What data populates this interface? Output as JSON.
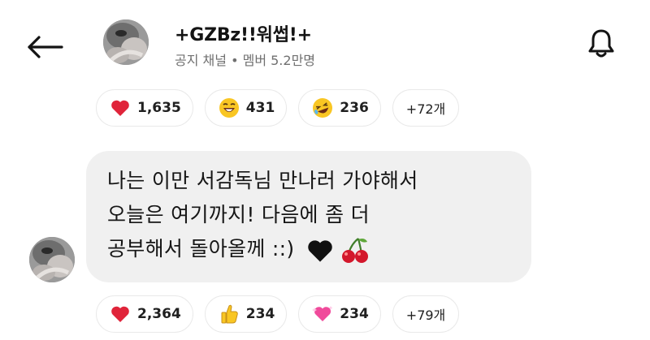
{
  "header": {
    "channel_name": "+GZBz!!워썹!+",
    "channel_type": "공지 채널",
    "separator": "•",
    "members": "멤버 5.2만명"
  },
  "icons": {
    "back": "arrow-left-icon",
    "bell": "bell-icon"
  },
  "reactions_top": {
    "heart_count": "1,635",
    "laugh_count": "431",
    "rofl_count": "236",
    "more_label": "+72개"
  },
  "message": {
    "line1": "나는 이만 서감독님 만나러 가야해서",
    "line2": "오늘은 여기까지! 다음에 좀 더",
    "line3": "공부해서 돌아올께 ::)",
    "emojis": [
      "black-heart",
      "cherries"
    ]
  },
  "reactions_bottom": {
    "heart_count": "2,364",
    "thumbs_count": "234",
    "pink_heart_count": "234",
    "more_label": "+79개"
  },
  "colors": {
    "heart": "#e0243a",
    "bubble_bg": "#f0f0f0",
    "subtext": "#707070"
  }
}
